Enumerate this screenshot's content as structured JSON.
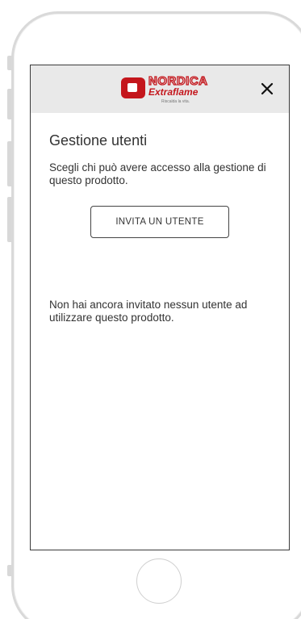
{
  "header": {
    "logo": {
      "brand": "NORDICA",
      "sub": "Extraflame",
      "tagline": "Riscalda la vita."
    },
    "close_icon": "close-icon"
  },
  "main": {
    "title": "Gestione utenti",
    "description": "Scegli chi può avere accesso alla gestione di questo prodotto.",
    "invite_button": "INVITA UN UTENTE",
    "empty_message": "Non hai ancora invitato nessun utente ad utilizzare questo prodotto."
  },
  "colors": {
    "brand_red": "#c4161c",
    "header_bg": "#e9e9e9",
    "text": "#333333"
  }
}
